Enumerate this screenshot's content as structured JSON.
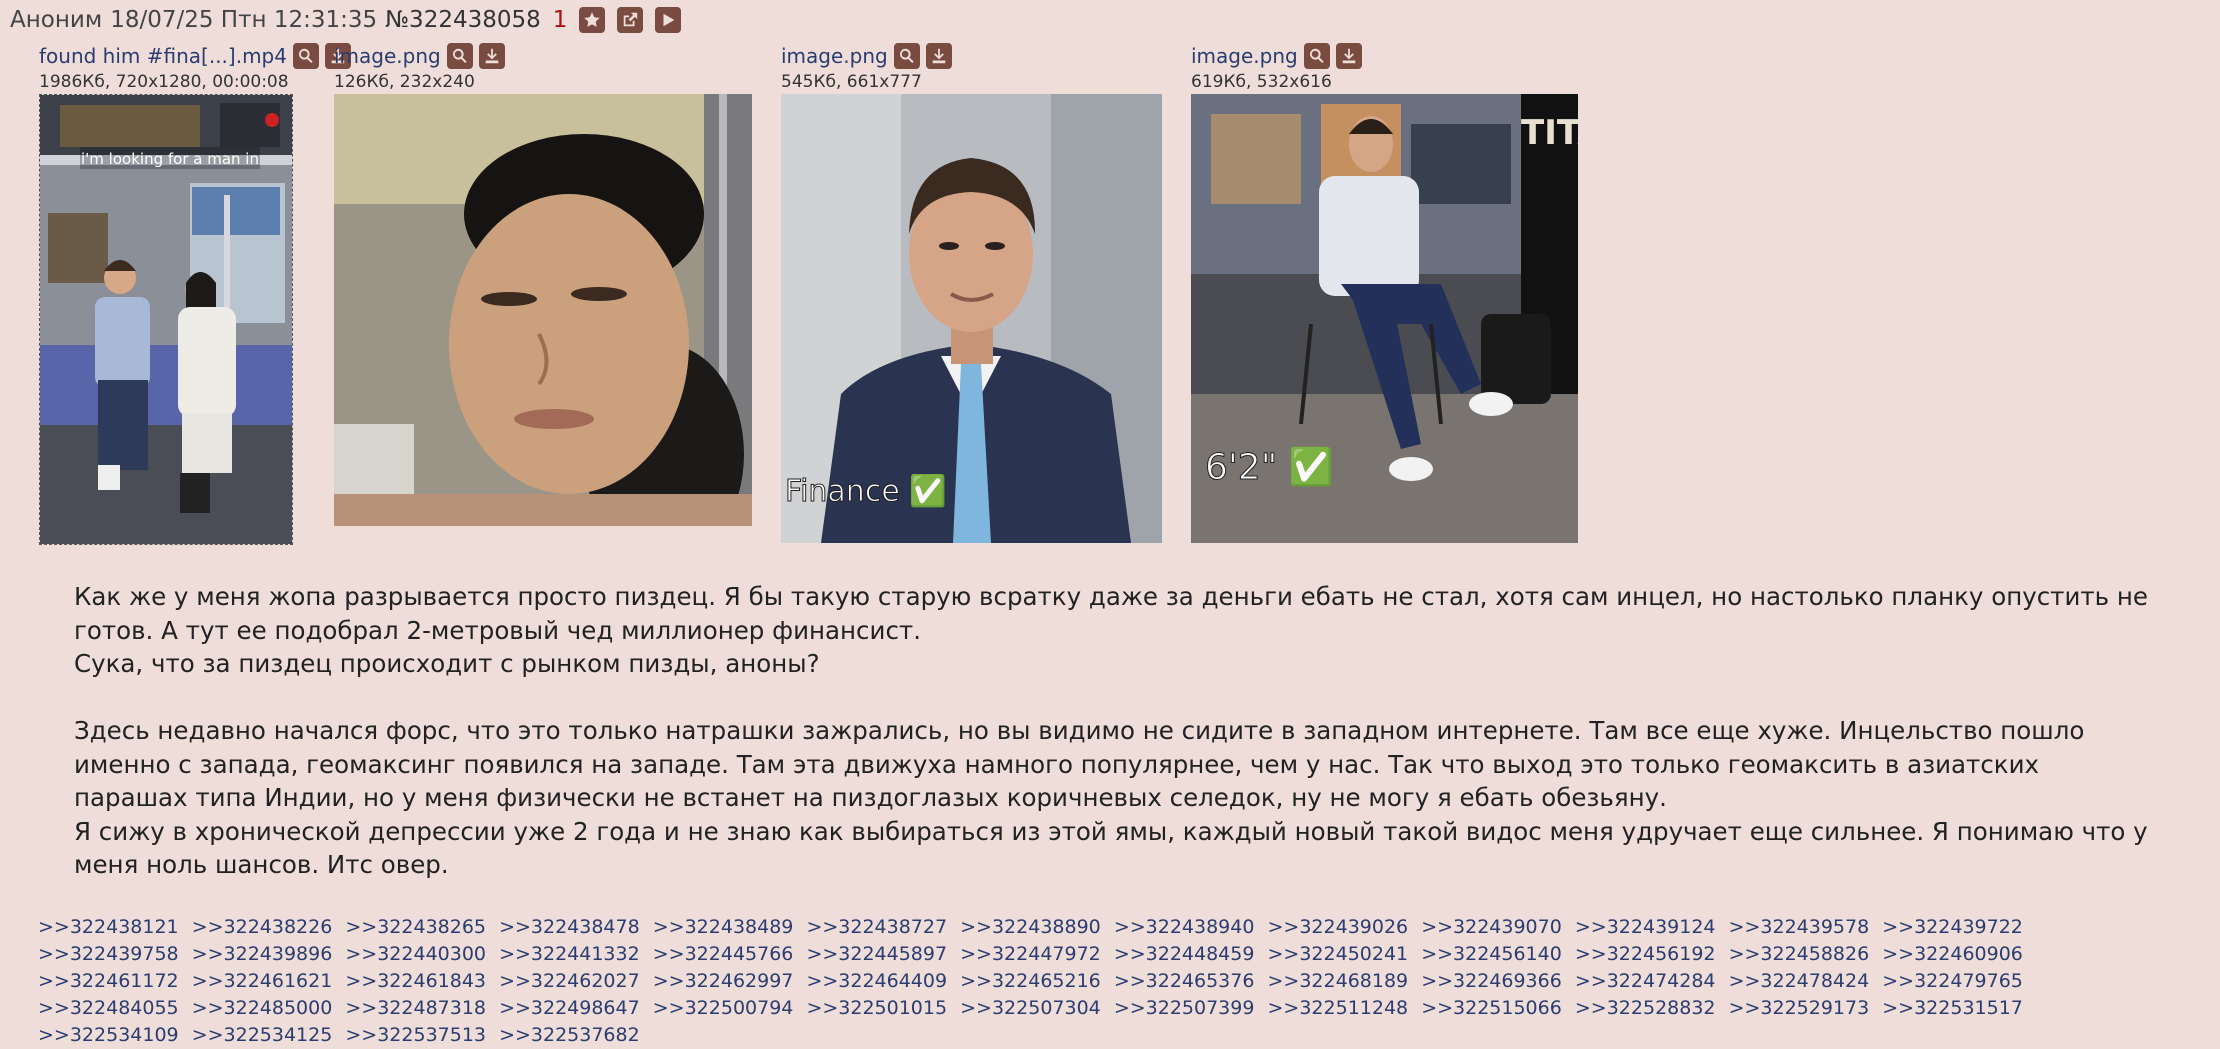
{
  "post": {
    "author": "Аноним",
    "datetime": "18/07/25 Птн 12:31:35",
    "number": "№322438058",
    "reply_count": "1"
  },
  "icons": {
    "star": "star-icon",
    "external": "external-link-icon",
    "play": "play-icon",
    "search": "search-icon",
    "download": "download-icon"
  },
  "files": [
    {
      "name": "found him #fina[...].mp4",
      "info": "1986Кб, 720x1280, 00:00:08"
    },
    {
      "name": "image.png",
      "info": "126Кб, 232x240"
    },
    {
      "name": "image.png",
      "info": "545Кб, 661x777"
    },
    {
      "name": "image.png",
      "info": "619Кб, 532x616"
    }
  ],
  "thumb_captions": {
    "video": "i'm looking for a man in",
    "finance": "Finance ✅",
    "height": "6'2\" ✅",
    "poster": "TITA"
  },
  "message": {
    "p1": "Как же у меня жопа разрывается просто пиздец. Я бы такую старую всратку даже за деньги ебать не стал, хотя сам инцел, но настолько планку опустить не готов. А тут ее подобрал 2-метровый чед миллионер финансист.",
    "p2": "Сука, что за пиздец происходит с рынком пизды, аноны?",
    "p3": "Здесь недавно начался форс, что это только натрашки зажрались, но вы видимо не сидите в западном интернете. Там все еще хуже. Инцельство пошло именно с запада, геомаксинг появился на западе. Там эта движуха намного популярнее, чем у нас. Так что выход это только геомаксить в азиатских парашах типа Индии, но у меня физически не встанет на пиздоглазых коричневых селедок, ну не могу я ебать обезьяну.",
    "p4": "Я сижу в хронической депрессии уже 2 года и не знаю как выбираться из этой ямы, каждый новый такой видос меня удручает еще сильнее. Я понимаю что у меня ноль шансов. Итс овер."
  },
  "replies": [
    ">>322438121",
    ">>322438226",
    ">>322438265",
    ">>322438478",
    ">>322438489",
    ">>322438727",
    ">>322438890",
    ">>322438940",
    ">>322439026",
    ">>322439070",
    ">>322439124",
    ">>322439578",
    ">>322439722",
    ">>322439758",
    ">>322439896",
    ">>322440300",
    ">>322441332",
    ">>322445766",
    ">>322445897",
    ">>322447972",
    ">>322448459",
    ">>322450241",
    ">>322456140",
    ">>322456192",
    ">>322458826",
    ">>322460906",
    ">>322461172",
    ">>322461621",
    ">>322461843",
    ">>322462027",
    ">>322462997",
    ">>322464409",
    ">>322465216",
    ">>322465376",
    ">>322468189",
    ">>322469366",
    ">>322474284",
    ">>322478424",
    ">>322479765",
    ">>322484055",
    ">>322485000",
    ">>322487318",
    ">>322498647",
    ">>322500794",
    ">>322501015",
    ">>322507304",
    ">>322507399",
    ">>322511248",
    ">>322515066",
    ">>322528832",
    ">>322529173",
    ">>322531517",
    ">>322534109",
    ">>322534125",
    ">>322537513",
    ">>322537682"
  ]
}
